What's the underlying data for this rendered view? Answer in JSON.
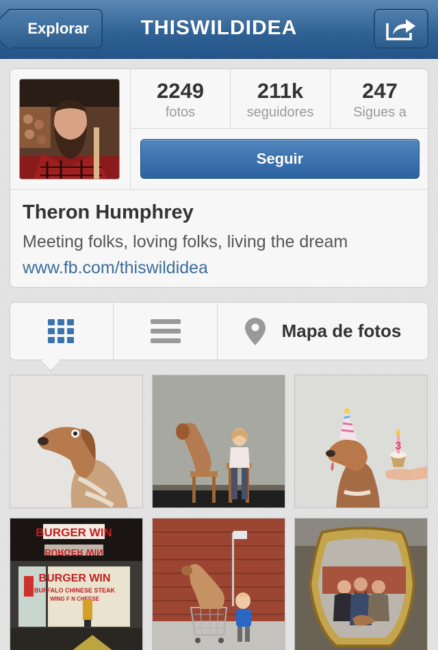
{
  "navbar": {
    "back_label": "Explorar",
    "title": "THISWILDIDEA",
    "share_icon": "share-arrow-icon"
  },
  "profile": {
    "stats": [
      {
        "value": "2249",
        "label": "fotos"
      },
      {
        "value": "211k",
        "label": "seguidores"
      },
      {
        "value": "247",
        "label": "Sigues a"
      }
    ],
    "follow_label": "Seguir",
    "name": "Theron Humphrey",
    "bio": "Meeting folks, loving folks, living the dream",
    "website": "www.fb.com/thiswildidea"
  },
  "tabs": {
    "grid_icon": "grid-icon",
    "list_icon": "list-icon",
    "map_icon": "map-pin-icon",
    "map_label": "Mapa de fotos"
  },
  "photos": {
    "burger_sign_top": "BURGER WIN",
    "burger_sign_mirror": "BURGER WIN",
    "burger_sign_window": "BURGER WIN",
    "burger_window_text": "BUFFALO CHINESE STEAK",
    "burger_window_text2": "WING  F  N CHEESE",
    "birthday_candle": "3"
  },
  "colors": {
    "navbar": "#2f6294",
    "follow_button": "#2b63a1",
    "link": "#3a6e9c",
    "active_tab_icon": "#3a73b0"
  }
}
